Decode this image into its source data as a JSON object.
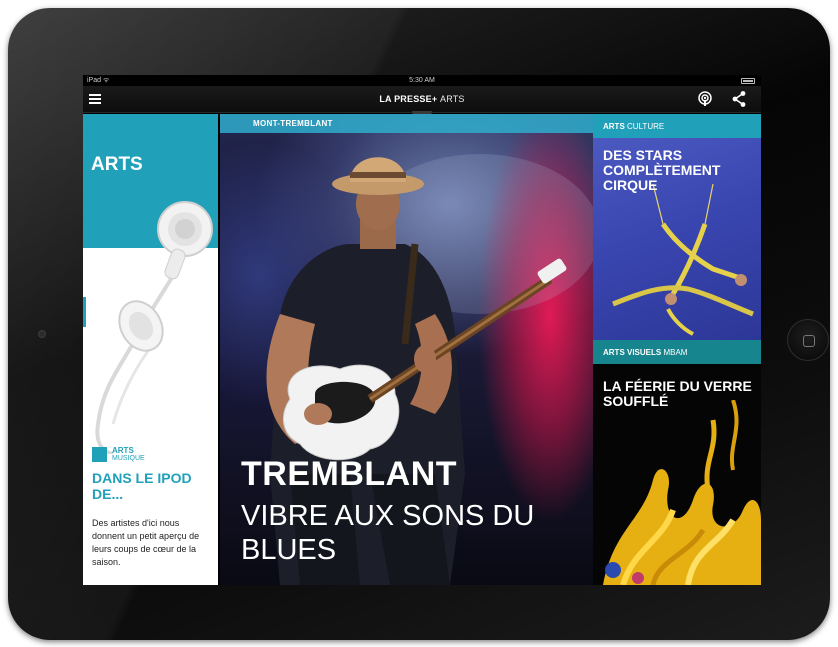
{
  "statusbar": {
    "carrier": "iPad ᯤ",
    "time": "5:30 AM"
  },
  "navbar": {
    "brand_name": "LA PRESSE",
    "brand_plus": "+",
    "brand_section": "ARTS"
  },
  "left_panel": {
    "section_title": "ARTS",
    "kicker_primary": "ARTS",
    "kicker_secondary": "MUSIQUE",
    "headline": "DANS LE IPOD DE...",
    "teaser": "Des artistes d'ici nous donnent un petit aperçu de leurs coups de cœur de la saison."
  },
  "feature": {
    "location_label": "MONT-TREMBLANT",
    "headline_bold": "TREMBLANT",
    "headline_rest": "VIBRE AUX SONS DU BLUES"
  },
  "right_panel": {
    "cards": [
      {
        "kicker_primary": "ARTS",
        "kicker_secondary": "CULTURE",
        "title": "DES STARS COMPLÈTEMENT CIRQUE"
      },
      {
        "kicker_primary": "ARTS VISUELS",
        "kicker_secondary": "MBAM",
        "title": "LA FÉERIE DU VERRE SOUFFLÉ"
      }
    ]
  },
  "colors": {
    "accent_teal": "#21a1b9",
    "label_bar_blue": "#2fadcd",
    "device_black": "#0a0a0a"
  },
  "icons": [
    "menu-icon",
    "podcast-icon",
    "share-icon",
    "battery-icon",
    "home-button-icon"
  ]
}
